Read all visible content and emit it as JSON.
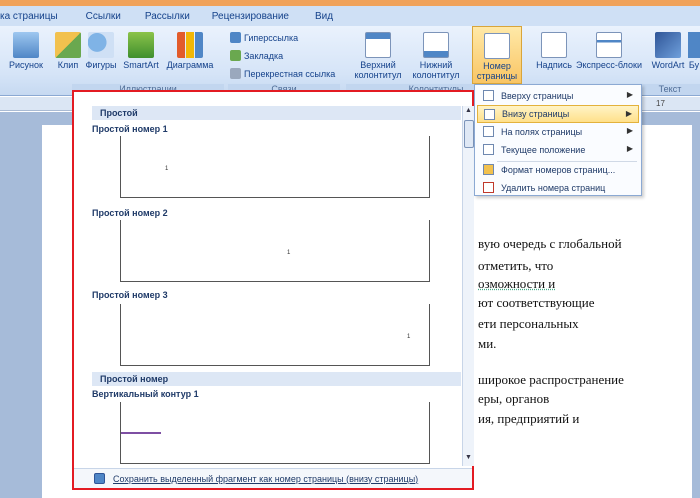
{
  "tabs": [
    "ка страницы",
    "Ссылки",
    "Рассылки",
    "Рецензирование",
    "Вид"
  ],
  "ribbon": {
    "illustrations": {
      "label": "Иллюстрации",
      "buttons": [
        "Рисунок",
        "Клип",
        "Фигуры",
        "SmartArt",
        "Диаграмма"
      ]
    },
    "links": {
      "label": "Связи",
      "items": [
        "Гиперссылка",
        "Закладка",
        "Перекрестная ссылка"
      ]
    },
    "headers": {
      "label": "Колонтитулы",
      "top_line1": "Верхний",
      "top_line2": "колонтитул",
      "bottom_line1": "Нижний",
      "bottom_line2": "колонтитул",
      "page_line1": "Номер",
      "page_line2": "страницы"
    },
    "text": {
      "label": "Текст",
      "buttons": [
        "Надпись",
        "Экспресс-блоки",
        "WordArt",
        "Бу"
      ]
    }
  },
  "ruler_tick": "17",
  "gallery": {
    "section1": "Простой",
    "thumbs": [
      {
        "title": "Простой номер 1",
        "num": "1"
      },
      {
        "title": "Простой номер 2",
        "num": "1"
      },
      {
        "title": "Простой номер 3",
        "num": "1"
      }
    ],
    "section2": "Простой номер",
    "thumb4_title": "Вертикальный контур 1",
    "footer": "Сохранить выделенный фрагмент как номер страницы (внизу страницы)"
  },
  "menu": {
    "items": [
      "Вверху страницы",
      "Внизу страницы",
      "На полях страницы",
      "Текущее положение",
      "Формат номеров страниц...",
      "Удалить номера страниц"
    ]
  },
  "document": {
    "lines": [
      "вую очередь с глобальной",
      "отметить, что",
      "озможности и",
      "ют соответствующие",
      "ети персональных",
      "ми.",
      "широкое распространение",
      "еры, органов",
      "ия, предприятий и"
    ]
  },
  "colors": {
    "accent": "#e31b23",
    "ribbon": "#d5e4f7",
    "selected": "#ffe08a"
  }
}
